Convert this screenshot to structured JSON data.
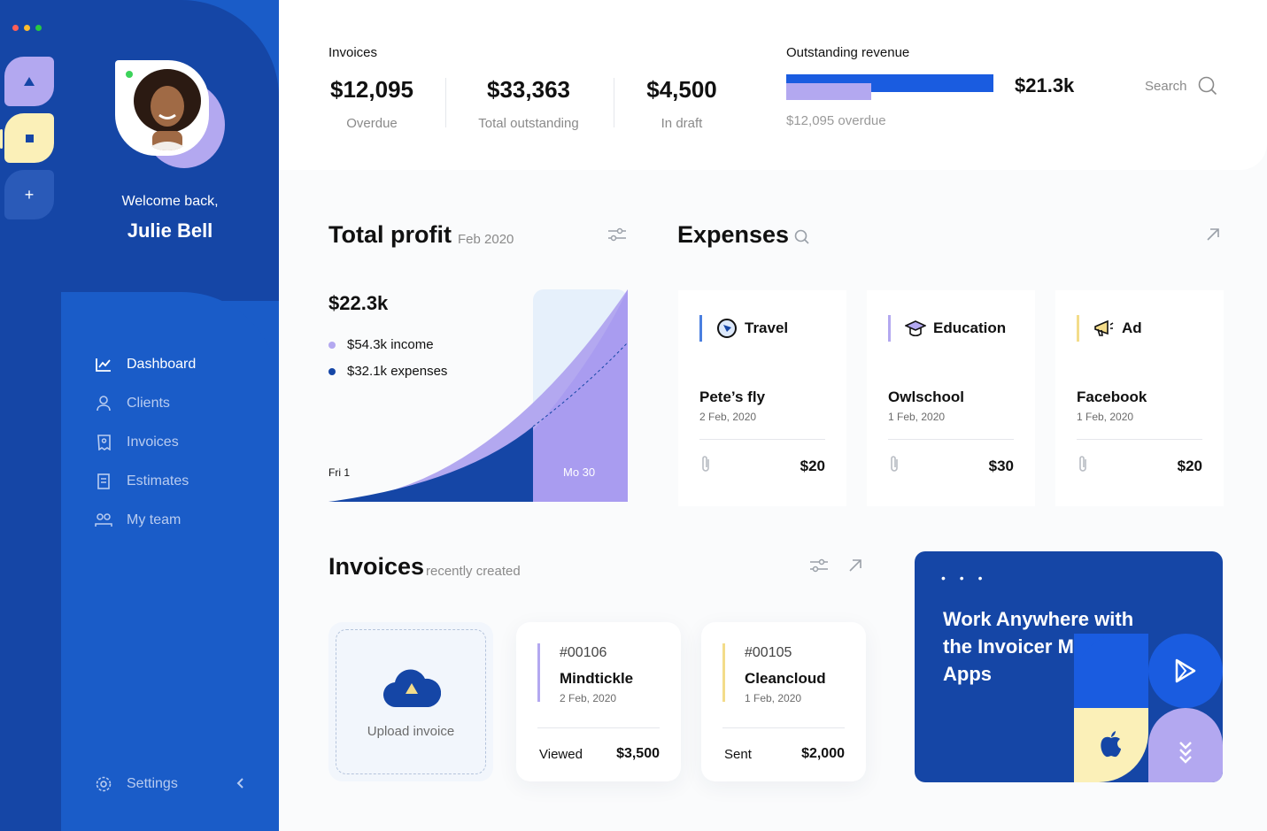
{
  "workspaces": [
    {
      "name": "workspace-triangle",
      "color": "#b3a8f0"
    },
    {
      "name": "workspace-square",
      "color": "#fbf0b8"
    },
    {
      "name": "workspace-add",
      "label": "+"
    }
  ],
  "user": {
    "welcome": "Welcome back,",
    "name": "Julie Bell",
    "status_color": "#3cd35a"
  },
  "nav": {
    "items": [
      {
        "label": "Dashboard",
        "icon": "chart-icon",
        "active": true
      },
      {
        "label": "Clients",
        "icon": "user-icon",
        "active": false
      },
      {
        "label": "Invoices",
        "icon": "invoice-icon",
        "active": false
      },
      {
        "label": "Estimates",
        "icon": "document-icon",
        "active": false
      },
      {
        "label": "My team",
        "icon": "team-icon",
        "active": false
      }
    ],
    "settings": "Settings",
    "collapse_icon": "chevron-left-icon"
  },
  "header": {
    "invoices_label": "Invoices",
    "stats": [
      {
        "value": "$12,095",
        "label": "Overdue"
      },
      {
        "value": "$33,363",
        "label": "Total outstanding"
      },
      {
        "value": "$4,500",
        "label": "In draft"
      }
    ],
    "outstanding_label": "Outstanding revenue",
    "outstanding_amount": "$21.3k",
    "overdue_note": "$12,095 overdue",
    "overdue_fraction": 0.41,
    "search_label": "Search"
  },
  "profit": {
    "title": "Total profit",
    "period": "Feb 2020",
    "amount": "$22.3k",
    "income": "$54.3k income",
    "expenses": "$32.1k expenses",
    "x_start": "Fri 1",
    "x_end": "Mo 30",
    "income_color": "#b3a8f0",
    "expenses_color": "#1546a6"
  },
  "expenses": {
    "title": "Expenses",
    "cards": [
      {
        "category": "Travel",
        "icon": "compass-icon",
        "accent": "#4a7fe0",
        "name": "Pete’s fly",
        "date": "2 Feb, 2020",
        "amount": "$20"
      },
      {
        "category": "Education",
        "icon": "graduation-cap-icon",
        "accent": "#b3a8f0",
        "name": "Owlschool",
        "date": "1 Feb, 2020",
        "amount": "$30"
      },
      {
        "category": "Ad",
        "icon": "megaphone-icon",
        "accent": "#f3dc8a",
        "name": "Facebook",
        "date": "1 Feb, 2020",
        "amount": "$20"
      }
    ]
  },
  "invoices": {
    "title": "Invoices",
    "subtitle": "recently created",
    "upload_label": "Upload invoice",
    "cards": [
      {
        "number": "#00106",
        "client": "Mindtickle",
        "date": "2 Feb, 2020",
        "status": "Viewed",
        "amount": "$3,500",
        "accent": "#b3a8f0"
      },
      {
        "number": "#00105",
        "client": "Cleancloud",
        "date": "1 Feb, 2020",
        "status": "Sent",
        "amount": "$2,000",
        "accent": "#f3dc8a"
      }
    ]
  },
  "promo": {
    "dots": "• • •",
    "text": "Work Anywhere with the Invoicer Mobile Apps"
  }
}
